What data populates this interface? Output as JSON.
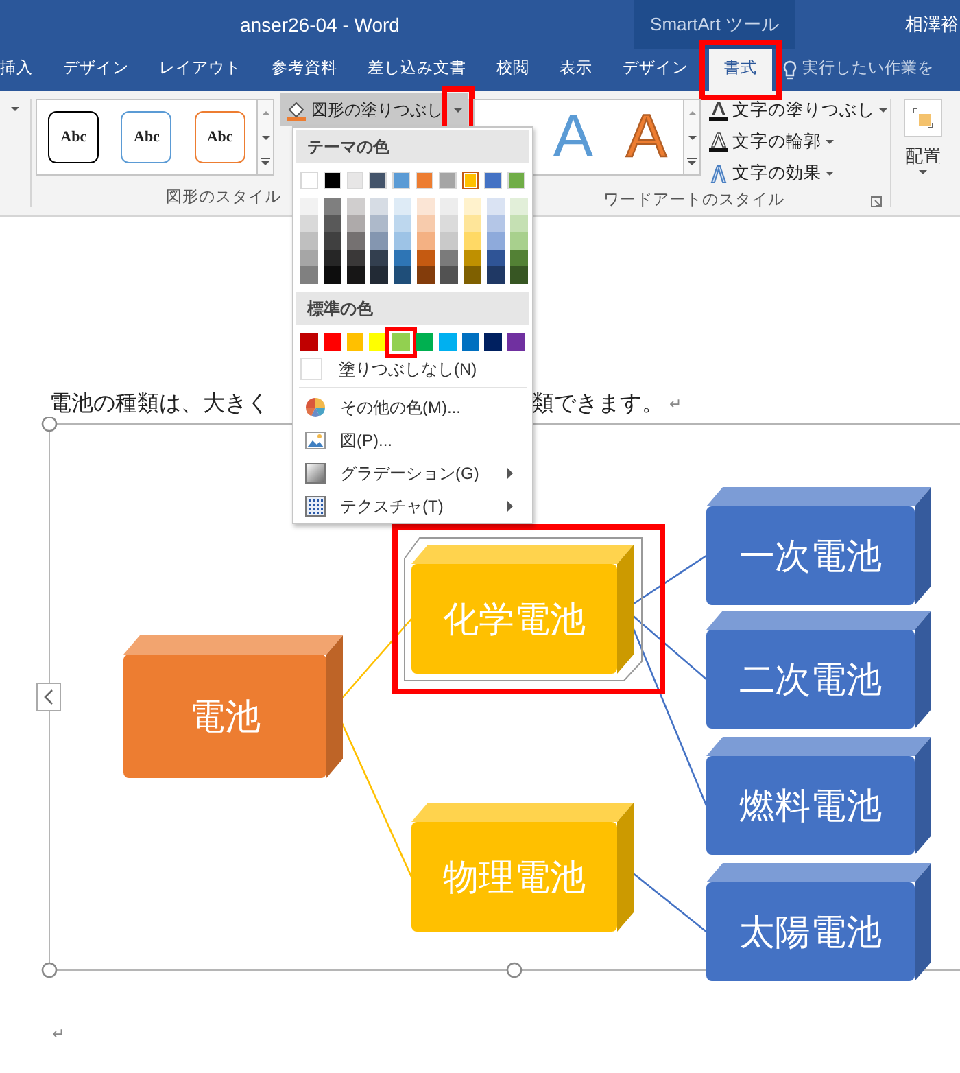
{
  "window": {
    "title": "anser26-04  -  Word",
    "context_tab_group": "SmartArt ツール",
    "user": "相澤裕"
  },
  "tabs": [
    {
      "label": "挿入",
      "selected": false,
      "highlighted": false
    },
    {
      "label": "デザイン",
      "selected": false,
      "highlighted": false
    },
    {
      "label": "レイアウト",
      "selected": false,
      "highlighted": false
    },
    {
      "label": "参考資料",
      "selected": false,
      "highlighted": false
    },
    {
      "label": "差し込み文書",
      "selected": false,
      "highlighted": false
    },
    {
      "label": "校閲",
      "selected": false,
      "highlighted": false
    },
    {
      "label": "表示",
      "selected": false,
      "highlighted": false
    },
    {
      "label": "デザイン",
      "selected": false,
      "highlighted": false
    },
    {
      "label": "書式",
      "selected": true,
      "highlighted": true
    }
  ],
  "tell_me": {
    "placeholder": "実行したい作業を"
  },
  "shape_styles": {
    "label": "図形のスタイル",
    "styles": [
      {
        "label": "Abc",
        "color": "#000000"
      },
      {
        "label": "Abc",
        "color": "#5b9bd5"
      },
      {
        "label": "Abc",
        "color": "#ed7d31"
      }
    ],
    "fill_button": {
      "label": "図形の塗りつぶし",
      "expanded": true,
      "highlighted": true
    }
  },
  "wordart_styles": {
    "label": "ワードアートのスタイル",
    "styles": [
      {
        "label": "A",
        "kind": "solid",
        "color": "#5b9bd5"
      },
      {
        "label": "A",
        "kind": "outline",
        "color": "#ed7d31"
      }
    ],
    "buttons": [
      {
        "label": "文字の塗りつぶし",
        "kind": "fill"
      },
      {
        "label": "文字の輪郭",
        "kind": "outline"
      },
      {
        "label": "文字の効果",
        "kind": "effect"
      }
    ]
  },
  "arrange": {
    "label": "配置"
  },
  "fill_menu": {
    "theme_heading": "テーマの色",
    "theme_colors": [
      {
        "color": "#ffffff",
        "selected": false,
        "shades": [
          {
            "color": "#f2f2f2"
          },
          {
            "color": "#d9d9d9"
          },
          {
            "color": "#bfbfbf"
          },
          {
            "color": "#a6a6a6"
          },
          {
            "color": "#808080"
          }
        ]
      },
      {
        "color": "#000000",
        "selected": false,
        "shades": [
          {
            "color": "#7f7f7f"
          },
          {
            "color": "#595959"
          },
          {
            "color": "#404040"
          },
          {
            "color": "#262626"
          },
          {
            "color": "#0d0d0d"
          }
        ]
      },
      {
        "color": "#e7e6e6",
        "selected": false,
        "shades": [
          {
            "color": "#d0cece"
          },
          {
            "color": "#aeaaaa"
          },
          {
            "color": "#757171"
          },
          {
            "color": "#3a3838"
          },
          {
            "color": "#171616"
          }
        ]
      },
      {
        "color": "#44546a",
        "selected": false,
        "shades": [
          {
            "color": "#d6dce4"
          },
          {
            "color": "#adb9ca"
          },
          {
            "color": "#8496b0"
          },
          {
            "color": "#333f4f"
          },
          {
            "color": "#222a35"
          }
        ]
      },
      {
        "color": "#5b9bd5",
        "selected": false,
        "shades": [
          {
            "color": "#deebf6"
          },
          {
            "color": "#bdd7ee"
          },
          {
            "color": "#9dc3e6"
          },
          {
            "color": "#2e75b5"
          },
          {
            "color": "#1f4e79"
          }
        ]
      },
      {
        "color": "#ed7d31",
        "selected": false,
        "shades": [
          {
            "color": "#fbe5d5"
          },
          {
            "color": "#f7cbac"
          },
          {
            "color": "#f4b183"
          },
          {
            "color": "#c55a11"
          },
          {
            "color": "#833c0b"
          }
        ]
      },
      {
        "color": "#a5a5a5",
        "selected": false,
        "shades": [
          {
            "color": "#ededed"
          },
          {
            "color": "#dbdbdb"
          },
          {
            "color": "#c9c9c9"
          },
          {
            "color": "#7b7b7b"
          },
          {
            "color": "#525252"
          }
        ]
      },
      {
        "color": "#ffc000",
        "selected": true,
        "shades": [
          {
            "color": "#fff2cc"
          },
          {
            "color": "#fee599"
          },
          {
            "color": "#ffd965"
          },
          {
            "color": "#bf9000"
          },
          {
            "color": "#7f6000"
          }
        ]
      },
      {
        "color": "#4472c4",
        "selected": false,
        "shades": [
          {
            "color": "#dae3f3"
          },
          {
            "color": "#b4c6e7"
          },
          {
            "color": "#8eaadb"
          },
          {
            "color": "#2f5496"
          },
          {
            "color": "#1f3864"
          }
        ]
      },
      {
        "color": "#70ad47",
        "selected": false,
        "shades": [
          {
            "color": "#e2efd9"
          },
          {
            "color": "#c5e0b3"
          },
          {
            "color": "#a8d08d"
          },
          {
            "color": "#538135"
          },
          {
            "color": "#375623"
          }
        ]
      }
    ],
    "standard_heading": "標準の色",
    "standard_colors": [
      {
        "color": "#c00000",
        "highlighted": false
      },
      {
        "color": "#ff0000",
        "highlighted": false
      },
      {
        "color": "#ffc000",
        "highlighted": false
      },
      {
        "color": "#ffff00",
        "highlighted": false
      },
      {
        "color": "#92d050",
        "highlighted": true
      },
      {
        "color": "#00b050",
        "highlighted": false
      },
      {
        "color": "#00b0f0",
        "highlighted": false
      },
      {
        "color": "#0070c0",
        "highlighted": false
      },
      {
        "color": "#002060",
        "highlighted": false
      },
      {
        "color": "#7030a0",
        "highlighted": false
      }
    ],
    "no_fill": "塗りつぶしなし(N)",
    "items": [
      {
        "kind": "palette",
        "label": "その他の色(M)...",
        "submenu": false
      },
      {
        "kind": "picture",
        "label": "図(P)...",
        "submenu": false
      },
      {
        "kind": "gradient",
        "label": "グラデーション(G)",
        "submenu": true
      },
      {
        "kind": "texture",
        "label": "テクスチャ(T)",
        "submenu": true
      }
    ]
  },
  "document": {
    "paragraph_parts": [
      "電池の種類は、大きく",
      "類できます。"
    ],
    "paragraph_mark": "↵",
    "empty_paragraph_mark": "↵"
  },
  "diagram": {
    "nodes": [
      {
        "label": "電池",
        "color": "#ed7d31",
        "selected": false,
        "highlighted": false,
        "children": [
          {
            "label": "化学電池",
            "color": "#ffc000",
            "selected": true,
            "highlighted": true,
            "children": [
              {
                "label": "一次電池",
                "color": "#4472c4",
                "selected": false,
                "highlighted": false
              },
              {
                "label": "二次電池",
                "color": "#4472c4",
                "selected": false,
                "highlighted": false
              },
              {
                "label": "燃料電池",
                "color": "#4472c4",
                "selected": false,
                "highlighted": false
              }
            ]
          },
          {
            "label": "物理電池",
            "color": "#ffc000",
            "selected": false,
            "highlighted": false,
            "children": [
              {
                "label": "太陽電池",
                "color": "#4472c4",
                "selected": false,
                "highlighted": false
              }
            ]
          }
        ]
      }
    ]
  }
}
